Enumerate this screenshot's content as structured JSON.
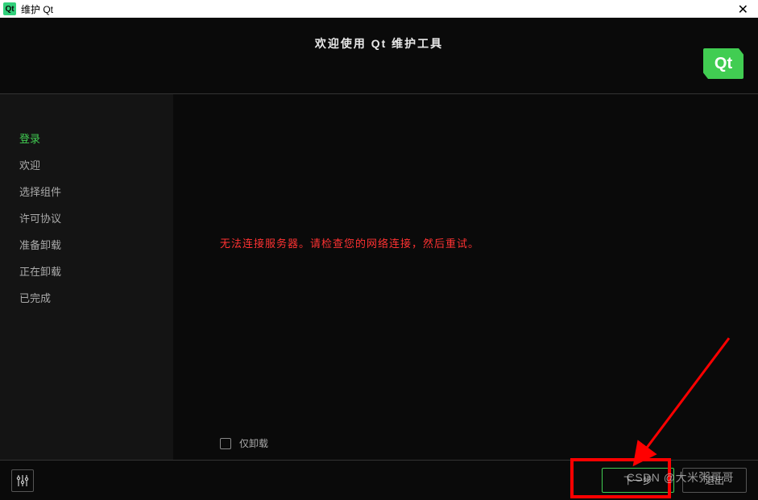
{
  "titlebar": {
    "icon_label": "Qt",
    "title": "维护 Qt"
  },
  "header": {
    "title": "欢迎使用 Qt 维护工具",
    "logo_text": "Qt"
  },
  "sidebar": {
    "items": [
      {
        "label": "登录",
        "active": true
      },
      {
        "label": "欢迎",
        "active": false
      },
      {
        "label": "选择组件",
        "active": false
      },
      {
        "label": "许可协议",
        "active": false
      },
      {
        "label": "准备卸载",
        "active": false
      },
      {
        "label": "正在卸载",
        "active": false
      },
      {
        "label": "已完成",
        "active": false
      }
    ]
  },
  "main": {
    "error_message": "无法连接服务器。请检查您的网络连接，然后重试。",
    "uninstall_only_label": "仅卸载"
  },
  "footer": {
    "next_label": "下一步",
    "quit_label": "退出"
  },
  "watermark": "CSDN @大米粥哥哥"
}
